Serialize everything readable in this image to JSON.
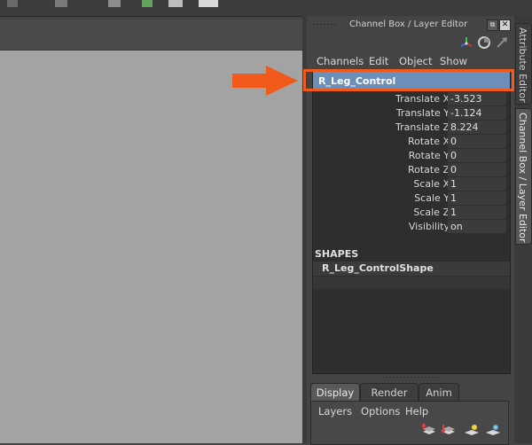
{
  "panel": {
    "title": "Channel Box / Layer Editor",
    "float_glyph": "⧉",
    "close_glyph": "✕"
  },
  "menu": [
    "Channels",
    "Edit",
    "Object",
    "Show"
  ],
  "channel_box": {
    "object_name": "R_Leg_Control",
    "attributes": [
      {
        "name": "Translate X",
        "value": "-3.523"
      },
      {
        "name": "Translate Y",
        "value": "-1.124"
      },
      {
        "name": "Translate Z",
        "value": "8.224"
      },
      {
        "name": "Rotate X",
        "value": "0"
      },
      {
        "name": "Rotate Y",
        "value": "0"
      },
      {
        "name": "Rotate Z",
        "value": "0"
      },
      {
        "name": "Scale X",
        "value": "1"
      },
      {
        "name": "Scale Y",
        "value": "1"
      },
      {
        "name": "Scale Z",
        "value": "1"
      },
      {
        "name": "Visibility",
        "value": "on"
      }
    ],
    "shapes_label": "SHAPES",
    "shape_name": "R_Leg_ControlShape"
  },
  "layer_editor": {
    "tabs": [
      "Display",
      "Render",
      "Anim"
    ],
    "menu": [
      "Layers",
      "Options",
      "Help"
    ]
  },
  "side_tabs": [
    "Attribute Editor",
    "Channel Box / Layer Editor"
  ],
  "colors": {
    "highlight": "#f05a1a",
    "selected_header": "#6b8fb8"
  },
  "icons": {
    "tool": [
      "axis-gizmo-icon",
      "rotate-manipulator-icon",
      "move-arrow-icon"
    ],
    "layer": [
      "new-layer-up-icon",
      "new-layer-down-icon",
      "new-layer-icon",
      "new-layer-selected-icon"
    ]
  }
}
